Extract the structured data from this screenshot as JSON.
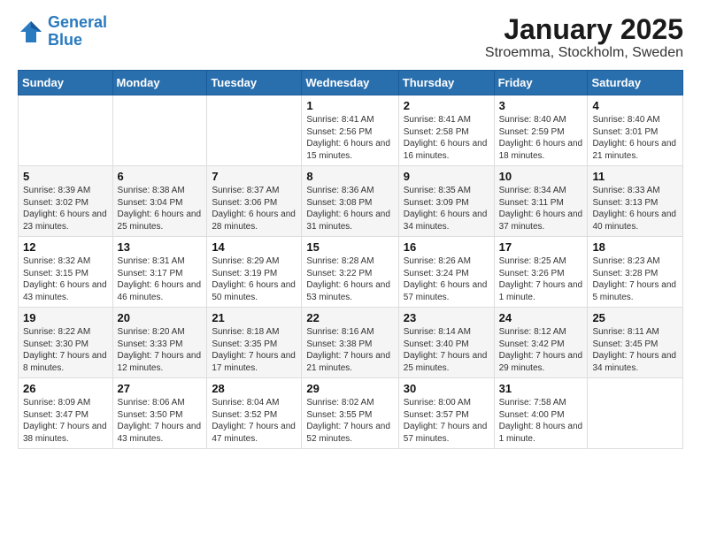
{
  "logo": {
    "line1": "General",
    "line2": "Blue"
  },
  "title": "January 2025",
  "subtitle": "Stroemma, Stockholm, Sweden",
  "weekdays": [
    "Sunday",
    "Monday",
    "Tuesday",
    "Wednesday",
    "Thursday",
    "Friday",
    "Saturday"
  ],
  "weeks": [
    [
      {
        "day": "",
        "info": ""
      },
      {
        "day": "",
        "info": ""
      },
      {
        "day": "",
        "info": ""
      },
      {
        "day": "1",
        "info": "Sunrise: 8:41 AM\nSunset: 2:56 PM\nDaylight: 6 hours\nand 15 minutes."
      },
      {
        "day": "2",
        "info": "Sunrise: 8:41 AM\nSunset: 2:58 PM\nDaylight: 6 hours\nand 16 minutes."
      },
      {
        "day": "3",
        "info": "Sunrise: 8:40 AM\nSunset: 2:59 PM\nDaylight: 6 hours\nand 18 minutes."
      },
      {
        "day": "4",
        "info": "Sunrise: 8:40 AM\nSunset: 3:01 PM\nDaylight: 6 hours\nand 21 minutes."
      }
    ],
    [
      {
        "day": "5",
        "info": "Sunrise: 8:39 AM\nSunset: 3:02 PM\nDaylight: 6 hours\nand 23 minutes."
      },
      {
        "day": "6",
        "info": "Sunrise: 8:38 AM\nSunset: 3:04 PM\nDaylight: 6 hours\nand 25 minutes."
      },
      {
        "day": "7",
        "info": "Sunrise: 8:37 AM\nSunset: 3:06 PM\nDaylight: 6 hours\nand 28 minutes."
      },
      {
        "day": "8",
        "info": "Sunrise: 8:36 AM\nSunset: 3:08 PM\nDaylight: 6 hours\nand 31 minutes."
      },
      {
        "day": "9",
        "info": "Sunrise: 8:35 AM\nSunset: 3:09 PM\nDaylight: 6 hours\nand 34 minutes."
      },
      {
        "day": "10",
        "info": "Sunrise: 8:34 AM\nSunset: 3:11 PM\nDaylight: 6 hours\nand 37 minutes."
      },
      {
        "day": "11",
        "info": "Sunrise: 8:33 AM\nSunset: 3:13 PM\nDaylight: 6 hours\nand 40 minutes."
      }
    ],
    [
      {
        "day": "12",
        "info": "Sunrise: 8:32 AM\nSunset: 3:15 PM\nDaylight: 6 hours\nand 43 minutes."
      },
      {
        "day": "13",
        "info": "Sunrise: 8:31 AM\nSunset: 3:17 PM\nDaylight: 6 hours\nand 46 minutes."
      },
      {
        "day": "14",
        "info": "Sunrise: 8:29 AM\nSunset: 3:19 PM\nDaylight: 6 hours\nand 50 minutes."
      },
      {
        "day": "15",
        "info": "Sunrise: 8:28 AM\nSunset: 3:22 PM\nDaylight: 6 hours\nand 53 minutes."
      },
      {
        "day": "16",
        "info": "Sunrise: 8:26 AM\nSunset: 3:24 PM\nDaylight: 6 hours\nand 57 minutes."
      },
      {
        "day": "17",
        "info": "Sunrise: 8:25 AM\nSunset: 3:26 PM\nDaylight: 7 hours\nand 1 minute."
      },
      {
        "day": "18",
        "info": "Sunrise: 8:23 AM\nSunset: 3:28 PM\nDaylight: 7 hours\nand 5 minutes."
      }
    ],
    [
      {
        "day": "19",
        "info": "Sunrise: 8:22 AM\nSunset: 3:30 PM\nDaylight: 7 hours\nand 8 minutes."
      },
      {
        "day": "20",
        "info": "Sunrise: 8:20 AM\nSunset: 3:33 PM\nDaylight: 7 hours\nand 12 minutes."
      },
      {
        "day": "21",
        "info": "Sunrise: 8:18 AM\nSunset: 3:35 PM\nDaylight: 7 hours\nand 17 minutes."
      },
      {
        "day": "22",
        "info": "Sunrise: 8:16 AM\nSunset: 3:38 PM\nDaylight: 7 hours\nand 21 minutes."
      },
      {
        "day": "23",
        "info": "Sunrise: 8:14 AM\nSunset: 3:40 PM\nDaylight: 7 hours\nand 25 minutes."
      },
      {
        "day": "24",
        "info": "Sunrise: 8:12 AM\nSunset: 3:42 PM\nDaylight: 7 hours\nand 29 minutes."
      },
      {
        "day": "25",
        "info": "Sunrise: 8:11 AM\nSunset: 3:45 PM\nDaylight: 7 hours\nand 34 minutes."
      }
    ],
    [
      {
        "day": "26",
        "info": "Sunrise: 8:09 AM\nSunset: 3:47 PM\nDaylight: 7 hours\nand 38 minutes."
      },
      {
        "day": "27",
        "info": "Sunrise: 8:06 AM\nSunset: 3:50 PM\nDaylight: 7 hours\nand 43 minutes."
      },
      {
        "day": "28",
        "info": "Sunrise: 8:04 AM\nSunset: 3:52 PM\nDaylight: 7 hours\nand 47 minutes."
      },
      {
        "day": "29",
        "info": "Sunrise: 8:02 AM\nSunset: 3:55 PM\nDaylight: 7 hours\nand 52 minutes."
      },
      {
        "day": "30",
        "info": "Sunrise: 8:00 AM\nSunset: 3:57 PM\nDaylight: 7 hours\nand 57 minutes."
      },
      {
        "day": "31",
        "info": "Sunrise: 7:58 AM\nSunset: 4:00 PM\nDaylight: 8 hours\nand 1 minute."
      },
      {
        "day": "",
        "info": ""
      }
    ]
  ]
}
